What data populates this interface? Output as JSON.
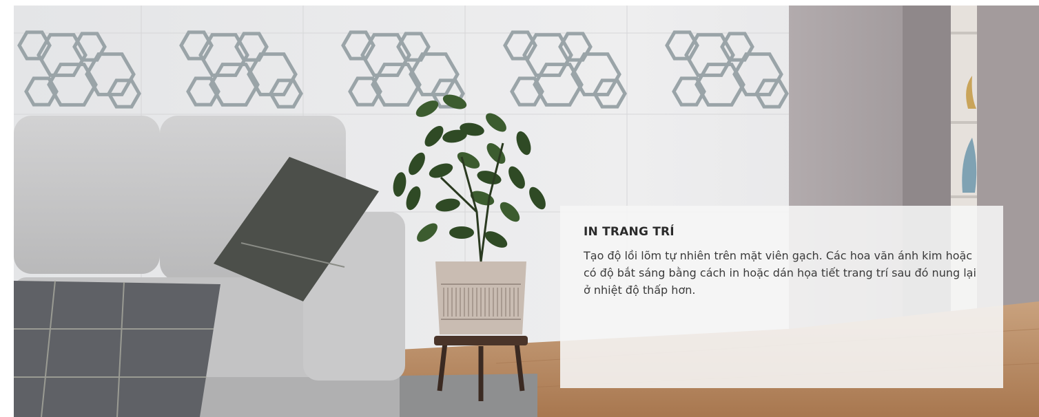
{
  "feature": {
    "title": "IN TRANG TRÍ",
    "description": "Tạo độ lồi lõm tự nhiên trên mặt viên gạch. Các hoa văn ánh kim hoặc có độ bắt sáng bằng cách in hoặc dán họa tiết trang trí sau đó nung lại ở nhiệt độ thấp hơn."
  },
  "scene": {
    "subjects": [
      "sofa",
      "cushion",
      "throw-blanket",
      "potted-plant",
      "hexagon-decor-tile-border",
      "wood-floor",
      "rug",
      "vase"
    ],
    "colors": {
      "wall": "#e9e9ea",
      "wall_panel_right": "#a7a0a2",
      "floor": "#b98b63",
      "sofa": "#c7c7c8",
      "cushion": "#4c4f4a",
      "plant_leaf": "#2f4a25",
      "pot": "#c9bcb2",
      "card_bg": "#f6f6f6",
      "title_text": "#2b2b2b",
      "body_text": "#3a3a3a"
    }
  }
}
